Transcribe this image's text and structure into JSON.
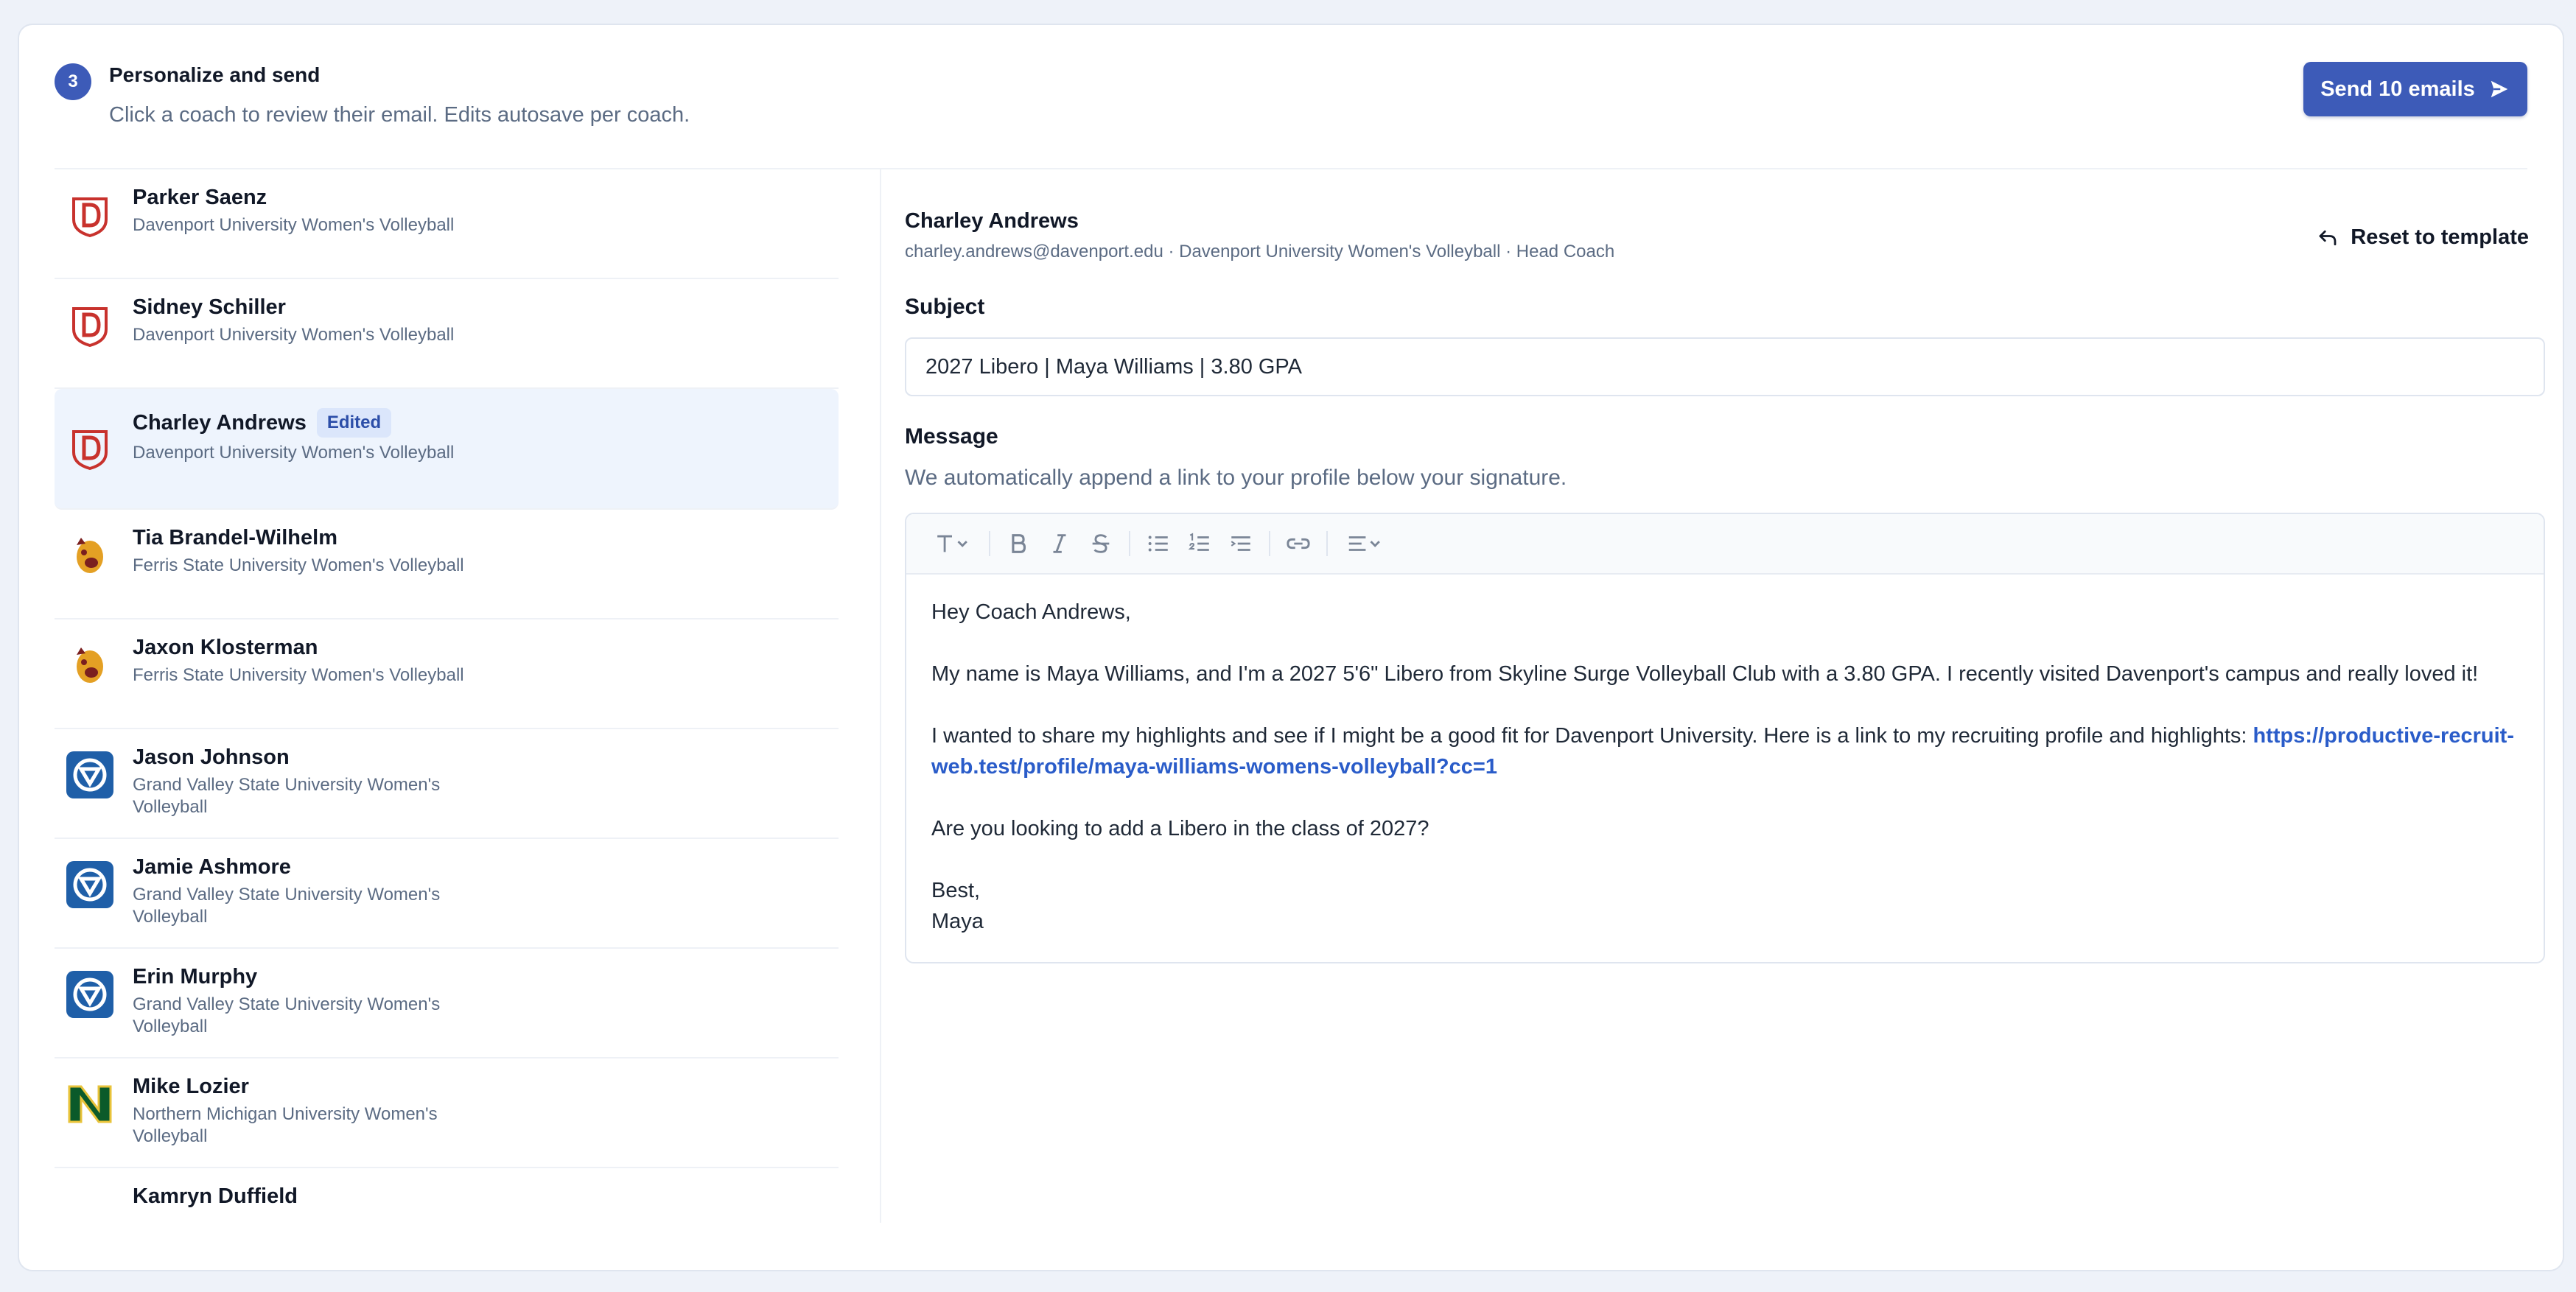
{
  "header": {
    "step_number": "3",
    "title": "Personalize and send",
    "subtitle": "Click a coach to review their email. Edits autosave per coach.",
    "send_button_label": "Send 10 emails"
  },
  "coaches": [
    {
      "name": "Parker Saenz",
      "school": "Davenport University Women's Volleyball",
      "logo": "davenport-logo"
    },
    {
      "name": "Sidney Schiller",
      "school": "Davenport University Women's Volleyball",
      "logo": "davenport-logo"
    },
    {
      "name": "Charley Andrews",
      "school": "Davenport University Women's Volleyball",
      "logo": "davenport-logo",
      "badge": "Edited",
      "selected": true
    },
    {
      "name": "Tia Brandel-Wilhelm",
      "school": "Ferris State University Women's Volleyball",
      "logo": "ferris-state-bulldog-logo"
    },
    {
      "name": "Jaxon Klosterman",
      "school": "Ferris State University Women's Volleyball",
      "logo": "ferris-state-bulldog-logo"
    },
    {
      "name": "Jason Johnson",
      "school": "Grand Valley State University Women's Volleyball",
      "logo": "grand-valley-logo"
    },
    {
      "name": "Jamie Ashmore",
      "school": "Grand Valley State University Women's Volleyball",
      "logo": "grand-valley-logo"
    },
    {
      "name": "Erin Murphy",
      "school": "Grand Valley State University Women's Volleyball",
      "logo": "grand-valley-logo"
    },
    {
      "name": "Mike Lozier",
      "school": "Northern Michigan University Women's Volleyball",
      "logo": "northern-michigan-logo"
    },
    {
      "name": "Kamryn Duffield",
      "school": "",
      "logo": ""
    }
  ],
  "selected_coach": {
    "name": "Charley Andrews",
    "meta": "charley.andrews@davenport.edu · Davenport University Women's Volleyball · Head Coach",
    "reset_label": "Reset to template"
  },
  "subject": {
    "label": "Subject",
    "value": "2027 Libero | Maya Williams | 3.80 GPA"
  },
  "message": {
    "label": "Message",
    "hint": "We automatically append a link to your profile below your signature.",
    "greeting": "Hey Coach Andrews,",
    "para1": "My name is Maya Williams, and I'm a 2027 5'6\" Libero from Skyline Surge Volleyball Club with a 3.80 GPA. I recently visited Davenport's campus and really loved it!",
    "para2_text": "I wanted to share my highlights and see if I might be a good fit for Davenport University. Here is a link to my recruiting profile and highlights: ",
    "para2_link": "https://productive-recruit-web.test/profile/maya-williams-womens-volleyball?cc=1",
    "para3": "Are you looking to add a Libero in the class of 2027?",
    "signoff": "Best,",
    "signature": "Maya"
  },
  "colors": {
    "accent": "#3d5bb8",
    "davenport_red": "#c8322d",
    "gvsu_blue": "#1f5fa8",
    "nmu_green": "#0b5a2a",
    "ferris_gold": "#e4a024"
  }
}
